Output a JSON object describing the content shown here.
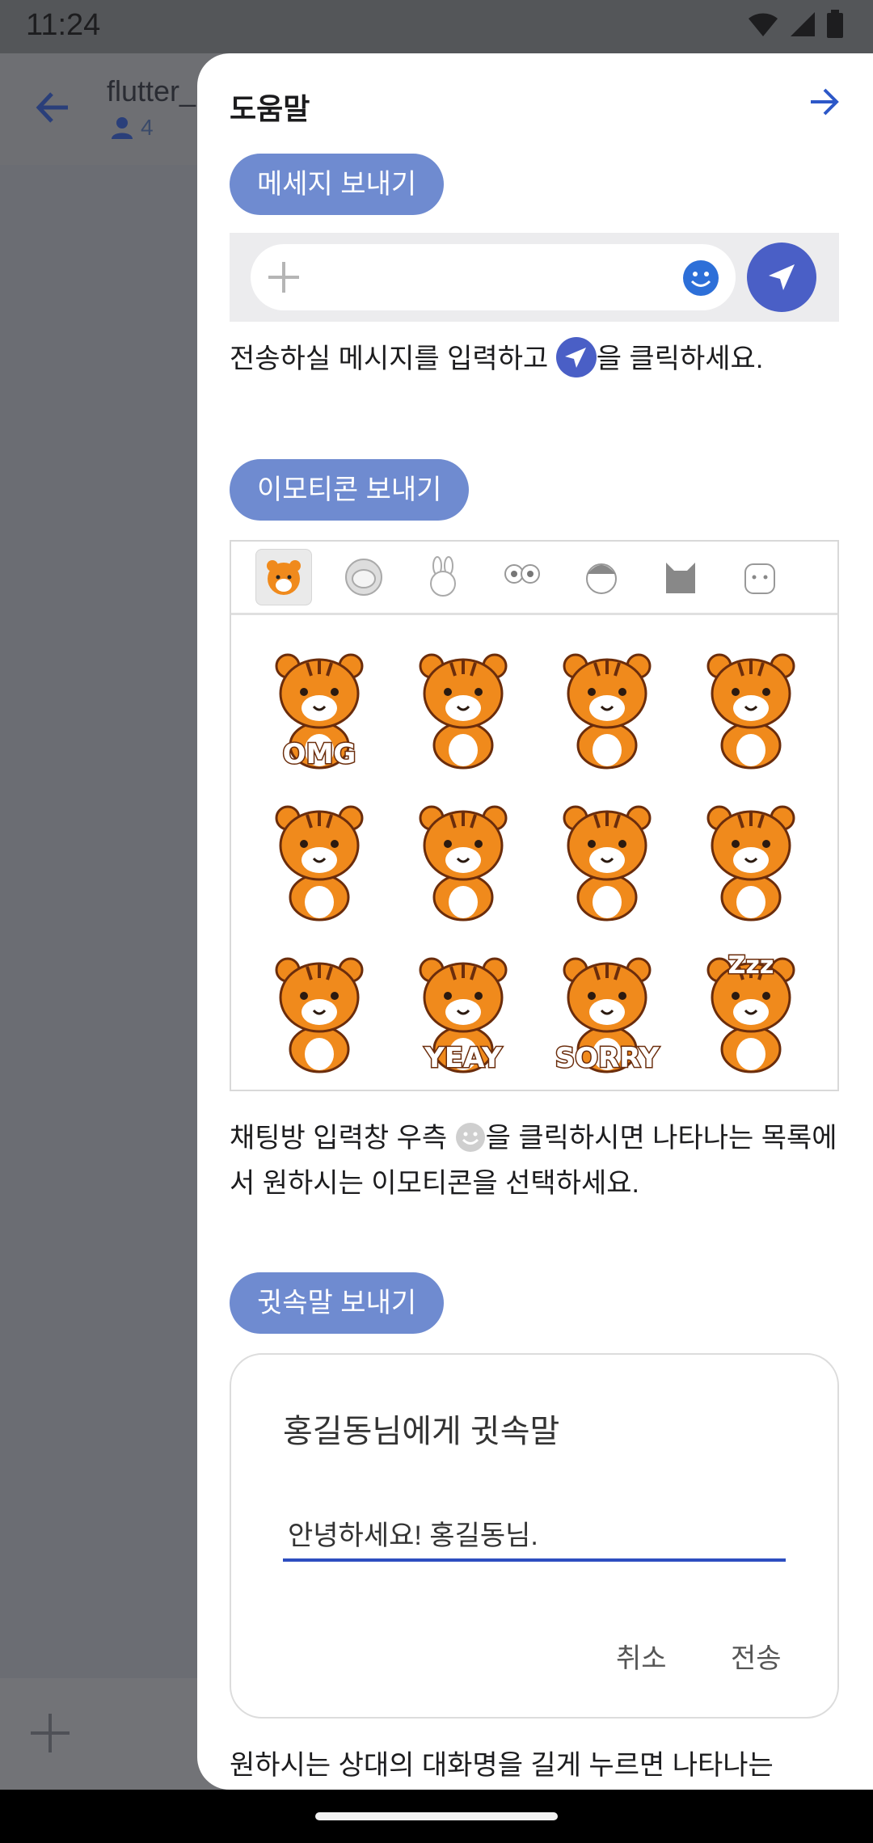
{
  "status_bar": {
    "time": "11:24"
  },
  "chat": {
    "title": "flutter_",
    "member_count": "4"
  },
  "drawer": {
    "title": "도움말",
    "sections": [
      {
        "pill": "메세지 보내기",
        "desc_before": "전송하실 메시지를 입력하고 ",
        "desc_after": "을 클릭하세요."
      },
      {
        "pill": "이모티콘 보내기",
        "desc_before": "채팅방 입력창 우측 ",
        "desc_after": "을 클릭하시면 나타나는 목록에서 원하시는 이모티콘을 선택하세요."
      },
      {
        "pill": "귓속말 보내기",
        "desc": "원하시는 상대의 대화명을 길게 누르면 나타나는"
      }
    ],
    "emoticon_tabs": [
      "tiger",
      "astronaut",
      "rabbit",
      "bug-eyes",
      "boy",
      "cat",
      "puppy"
    ],
    "stickers": [
      {
        "label": "OMG"
      },
      {
        "label": ""
      },
      {
        "label": ""
      },
      {
        "label": ""
      },
      {
        "label": ""
      },
      {
        "label": ""
      },
      {
        "label": ""
      },
      {
        "label": ""
      },
      {
        "label": ""
      },
      {
        "label": "YEAY"
      },
      {
        "label": "SORRY"
      },
      {
        "label": "Zzz"
      }
    ],
    "whisper_dialog": {
      "title": "홍길동님에게 귓속말",
      "input_value": "안녕하세요! 홍길동님.",
      "cancel_label": "취소",
      "send_label": "전송"
    }
  },
  "colors": {
    "pill": "#6f8bd0",
    "send_button": "#4a5fc6",
    "accent_blue": "#2d4ec0",
    "tiger_orange": "#f08a1c"
  }
}
